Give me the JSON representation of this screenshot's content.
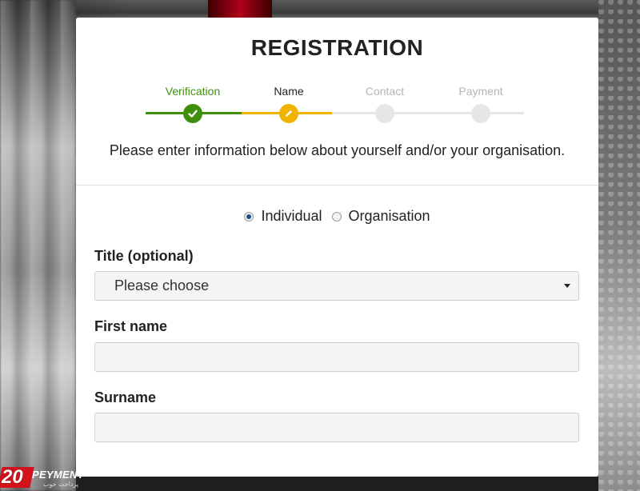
{
  "registration": {
    "title": "REGISTRATION",
    "steps": [
      {
        "label": "Verification",
        "status": "done",
        "color": "#3e8f0c"
      },
      {
        "label": "Name",
        "status": "current",
        "color": "#f0b400"
      },
      {
        "label": "Contact",
        "status": "pending",
        "color": "#c8c8c8"
      },
      {
        "label": "Payment",
        "status": "pending",
        "color": "#c8c8c8"
      }
    ],
    "intro": "Please enter information below about yourself and/or your organisation.",
    "account_type": {
      "options": [
        "Individual",
        "Organisation"
      ],
      "selected": "Individual"
    },
    "fields": {
      "title_label": "Title (optional)",
      "title_value": "Please choose",
      "first_name_label": "First name",
      "first_name_value": "",
      "surname_label": "Surname",
      "surname_value": ""
    }
  },
  "watermark": {
    "number": "20",
    "brand": "PEYMENT",
    "subtitle": "پرداخت خوب"
  }
}
